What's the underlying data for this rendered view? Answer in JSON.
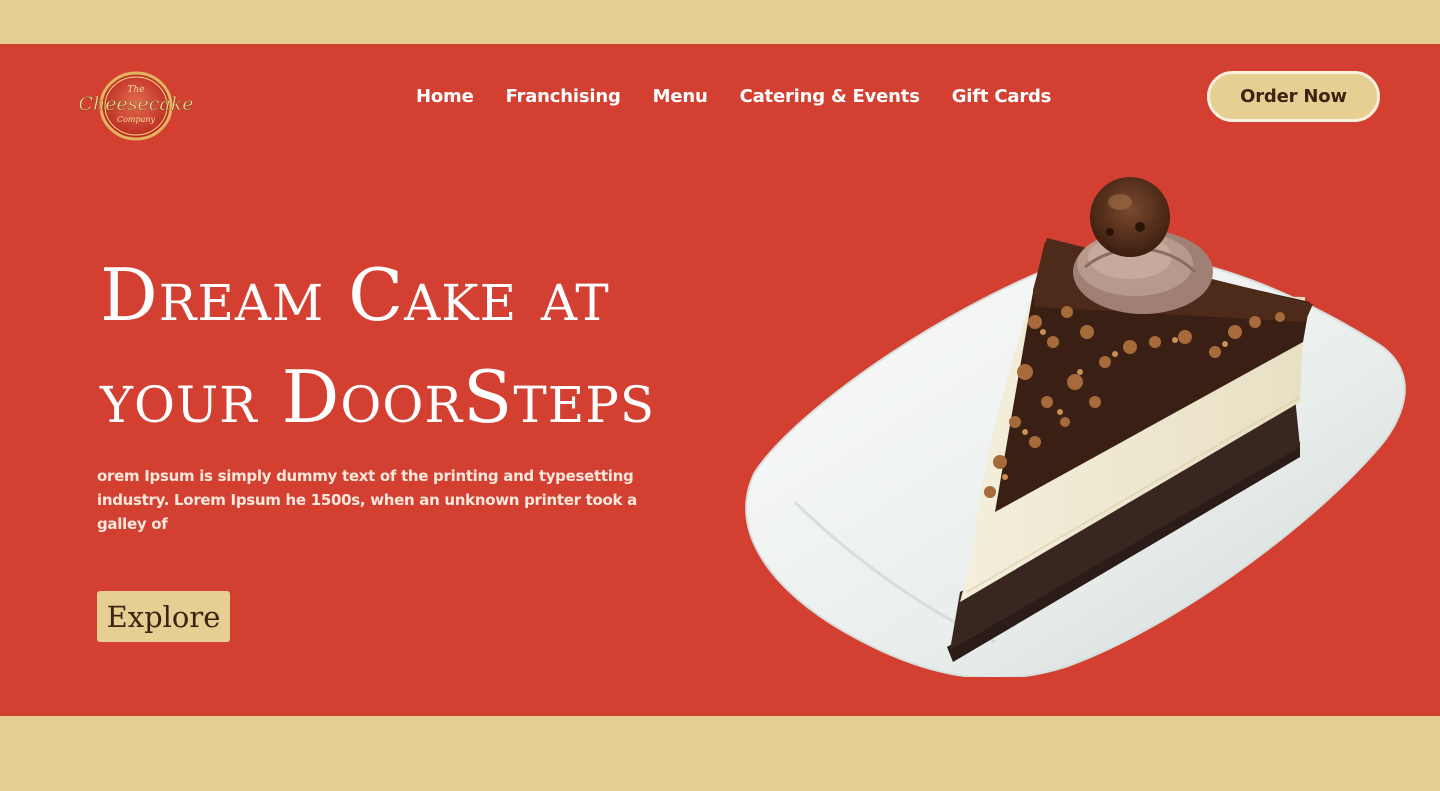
{
  "brand": {
    "logo_top": "The",
    "logo_main": "Cheesecake",
    "logo_bottom": "Company"
  },
  "nav": {
    "items": [
      {
        "label": "Home"
      },
      {
        "label": "Franchising"
      },
      {
        "label": "Menu"
      },
      {
        "label": "Catering & Events"
      },
      {
        "label": "Gift Cards"
      }
    ]
  },
  "header": {
    "order_label": "Order Now"
  },
  "hero": {
    "headline_line1": "Dream Cake at",
    "headline_line2": "your DoorSteps",
    "description": "orem Ipsum is simply dummy text of the printing and typesetting industry. Lorem Ipsum he 1500s, when an unknown printer took a galley of",
    "explore_label": "Explore",
    "image": "cheesecake-slice-on-plate"
  },
  "colors": {
    "page_bg": "#e6cf93",
    "hero_bg": "#d34032",
    "button_bg": "#e6cf93",
    "button_text": "#3c2410"
  }
}
